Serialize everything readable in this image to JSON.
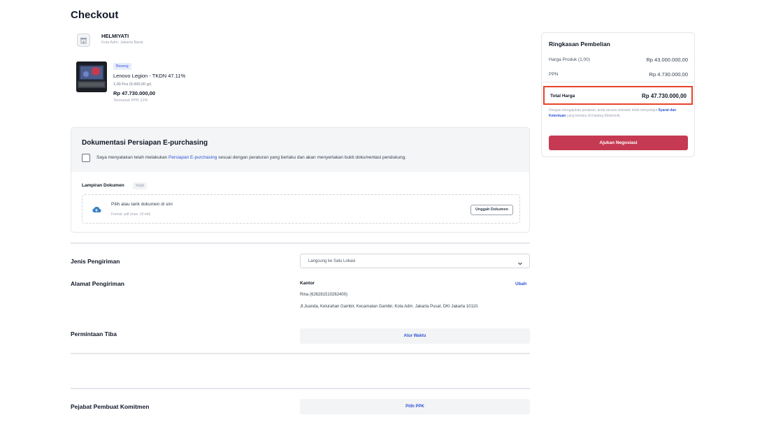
{
  "page": {
    "title": "Checkout"
  },
  "seller": {
    "name": "HELMIYATI",
    "location": "Kota Adm. Jakarta Barat",
    "icon": "store-icon"
  },
  "product": {
    "badge": "Barang",
    "name": "Lenovo Legion - TKDN 47.11%",
    "quantity": "1,00 Pcs (5.000,00 gr)",
    "price": "Rp 47.730.000,00",
    "tax_note": "Termasuk PPN 12%"
  },
  "documentation": {
    "title": "Dokumentasi Persiapan E-purchasing",
    "statement_before": "Saya menyatakan telah melakukan ",
    "statement_link": "Persiapan E-purchasing",
    "statement_after": " sesuai dengan peraturan yang berlaku dan akan menyertakan bukti dokumentasi pendukung.",
    "checked": false,
    "attachment_label": "Lampiran Dokumen",
    "required_badge": "Wajib",
    "drop_text": "Pilih atau tarik dokumen di sini",
    "drop_hint": "Format .pdf (max. 10 mb)",
    "upload_button": "Unggah Dokumen"
  },
  "shipping": {
    "type_label": "Jenis Pengiriman",
    "type_value": "Langsung ke Satu Lokasi",
    "address_label": "Alamat Pengiriman",
    "address_title": "Kantor",
    "address_edit": "Ubah",
    "recipient": "Rina (626281510262400)",
    "address": "Jl.Juanda, Kelurahan Gambir, Kecamatan Gambir, Kota Adm. Jakarta Pusat, DKI Jakarta 10110.",
    "arrival_label": "Permintaan Tiba",
    "arrival_button": "Atur Waktu"
  },
  "commitment": {
    "label": "Pejabat Pembuat Komitmen",
    "button": "Pilih PPK"
  },
  "summary": {
    "title": "Ringkasan Pembelian",
    "product_label": "Harga Produk (1,00)",
    "product_value": "Rp 43.000.000,00",
    "tax_label": "PPN",
    "tax_value": "Rp 4.730.000,00",
    "total_label": "Total Harga",
    "total_value": "Rp 47.730.000,00",
    "note_before": "Dengan mengajukan pesanan, anda secara otomatis telah menyetujui ",
    "note_link": "Syarat dan Ketentuan",
    "note_after": " yang berlaku di Katalog Elektronik.",
    "submit_button": "Ajukan Negosiasi"
  },
  "colors": {
    "accent": "#c53a52",
    "link": "#2f55d4",
    "highlight": "#e8432a"
  }
}
